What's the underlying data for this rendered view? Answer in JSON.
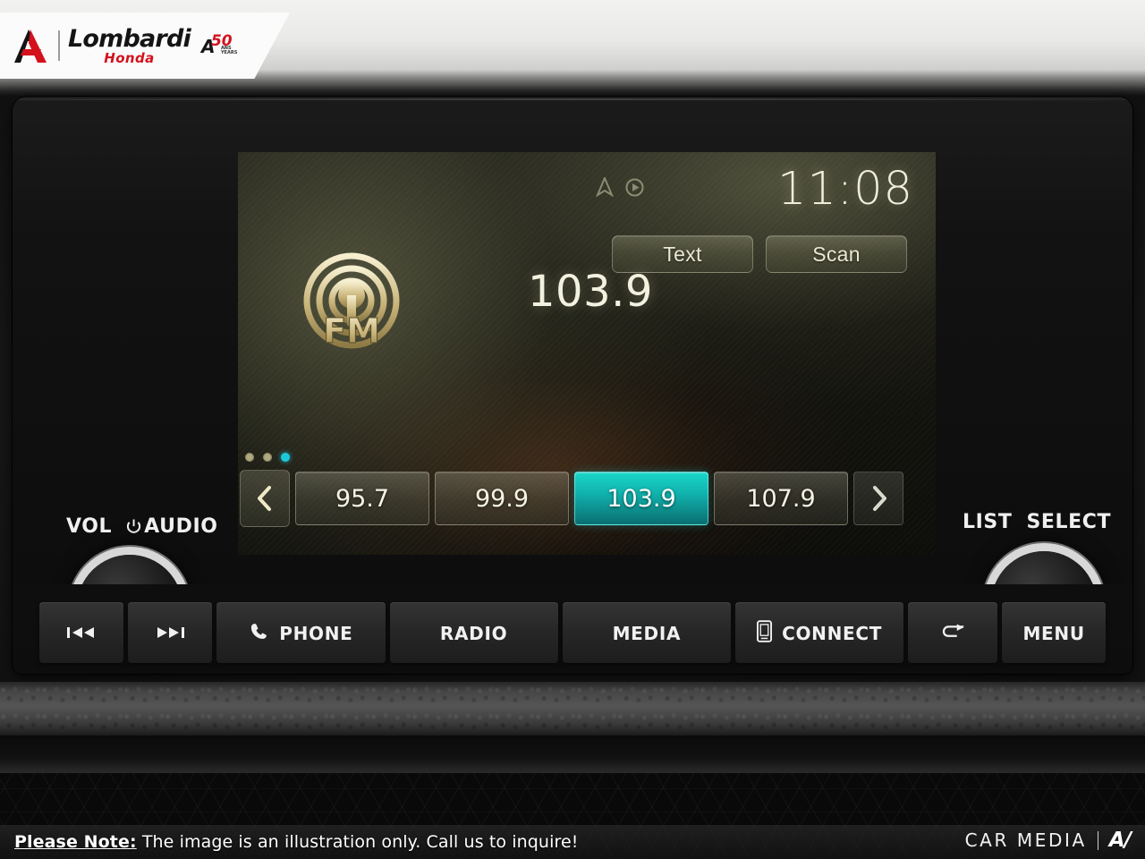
{
  "dealer": {
    "name": "Lombardi",
    "sub": "Honda",
    "badge_letter": "A",
    "badge_number": "50",
    "badge_caption": "ANS\nYEARS",
    "mark_icon": "lombardi-a-mark"
  },
  "screen": {
    "clock": "11:08",
    "status_icons": [
      {
        "name": "navigation-arrow-icon"
      },
      {
        "name": "play-circle-icon"
      }
    ],
    "buttons": [
      {
        "label": "Text",
        "name": "text-button"
      },
      {
        "label": "Scan",
        "name": "scan-button"
      }
    ],
    "source": {
      "band": "FM",
      "icon": "fm-broadcast-icon",
      "frequency": "103.9"
    },
    "page_dots": {
      "count": 3,
      "active_index": 2,
      "active_color": "#1ec8d8"
    },
    "preset_nav": {
      "prev_icon": "chevron-left-icon",
      "next_icon": "chevron-right-icon"
    },
    "presets": [
      {
        "label": "95.7",
        "active": false
      },
      {
        "label": "99.9",
        "active": false
      },
      {
        "label": "103.9",
        "active": true
      },
      {
        "label": "107.9",
        "active": false
      }
    ]
  },
  "controls": {
    "left_knob": {
      "label_1": "VOL",
      "label_2": "AUDIO",
      "power_icon": "power-icon",
      "knob_name": "volume-audio-knob"
    },
    "right_knob": {
      "label_1": "LIST",
      "label_2": "SELECT",
      "knob_name": "list-select-knob"
    }
  },
  "hard_keys": [
    {
      "label": "",
      "icon": "previous-track-icon",
      "name": "previous-track-button"
    },
    {
      "label": "",
      "icon": "next-track-icon",
      "name": "next-track-button"
    },
    {
      "label": "PHONE",
      "icon": "phone-handset-icon",
      "name": "phone-button"
    },
    {
      "label": "RADIO",
      "icon": "",
      "name": "radio-button"
    },
    {
      "label": "MEDIA",
      "icon": "",
      "name": "media-button"
    },
    {
      "label": "CONNECT",
      "icon": "smartphone-icon",
      "name": "connect-button"
    },
    {
      "label": "",
      "icon": "back-arrow-icon",
      "name": "back-button"
    },
    {
      "label": "MENU",
      "icon": "",
      "name": "menu-button"
    }
  ],
  "footer": {
    "note_bold": "Please Note:",
    "note_rest": " The image is an illustration only. Call us to inquire!",
    "watermark_text": "CAR MEDIA",
    "watermark_logo": "A/"
  },
  "colors": {
    "accent_teal": "#19d6c8",
    "brand_red": "#d3121d",
    "lcd_cream": "#f3f1df"
  }
}
